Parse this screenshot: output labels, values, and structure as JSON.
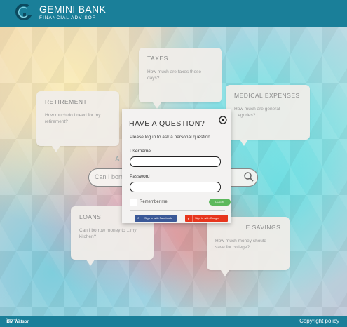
{
  "brand": {
    "name": "GEMINI BANK",
    "tagline": "FINANCIAL ADVISOR"
  },
  "bubbles": {
    "taxes": {
      "title": "TAXES",
      "question": "How much are taxes these days?"
    },
    "retirement": {
      "title": "RETIREMENT",
      "question": "How much do I need for my retirement?"
    },
    "medical": {
      "title": "MEDICAL EXPENSES",
      "question": "How much are general ...egories?"
    },
    "loans": {
      "title": "LOANS",
      "question": "Can I borrow money to ...my kitchen?"
    },
    "savings": {
      "title": "...E SAVINGS",
      "question": "How much money should I save for college?"
    }
  },
  "search": {
    "ask_label": "A",
    "placeholder": "Can I borr"
  },
  "modal": {
    "title": "HAVE A QUESTION?",
    "subtitle": "Please log in to ask a personal question.",
    "username_label": "Username",
    "password_label": "Password",
    "remember_label": "Remember me",
    "login_label": "LOGIN",
    "facebook_label": "Sign in with Facebook",
    "google_label": "Sign in with Google"
  },
  "footer": {
    "powered": "Powered by",
    "watson": "IBM Watson",
    "copyright": "Copyright policy"
  },
  "colors": {
    "header": "#1a7f99",
    "login": "#5cb85c",
    "facebook": "#3b5998",
    "google": "#e7361e"
  },
  "icons": [
    "logo-icon",
    "close-icon",
    "search-icon",
    "facebook-icon",
    "google-icon"
  ]
}
